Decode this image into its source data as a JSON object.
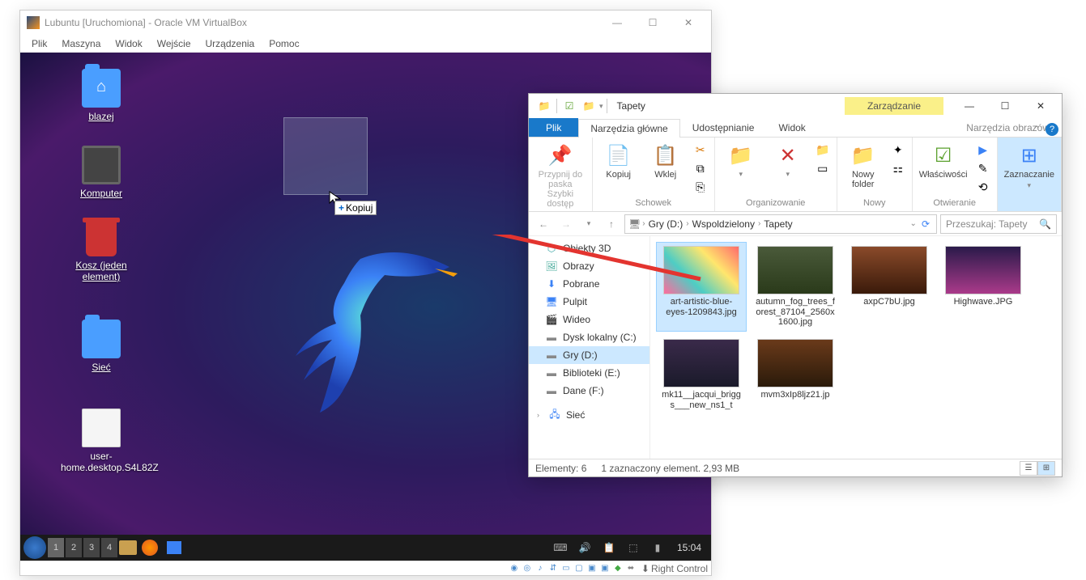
{
  "vbox": {
    "title": "Lubuntu [Uruchomiona] - Oracle VM VirtualBox",
    "menus": [
      "Plik",
      "Maszyna",
      "Widok",
      "Wejście",
      "Urządzenia",
      "Pomoc"
    ],
    "hostkey": "Right Control"
  },
  "desktop_icons": {
    "home": "blazej",
    "computer": "Komputer",
    "trash": "Kosz (jeden element)",
    "network": "Sieć",
    "file": "user-home.desktop.S4L82Z"
  },
  "drag_tooltip": "Kopiuj",
  "taskbar": {
    "desktops": [
      "1",
      "2",
      "3",
      "4"
    ],
    "time": "15:04"
  },
  "explorer": {
    "title": "Tapety",
    "manage_tab": "Zarządzanie",
    "tabs": {
      "file": "Plik",
      "home": "Narzędzia główne",
      "share": "Udostępnianie",
      "view": "Widok",
      "context": "Narzędzia obrazów"
    },
    "ribbon": {
      "pin": "Przypnij do paska Szybki dostęp",
      "copy": "Kopiuj",
      "paste": "Wklej",
      "clipboard": "Schowek",
      "organize": "Organizowanie",
      "newfolder": "Nowy folder",
      "new": "Nowy",
      "properties": "Właściwości",
      "open_group": "Otwieranie",
      "select": "Zaznaczanie"
    },
    "breadcrumbs": [
      "Gry (D:)",
      "Wspoldzielony",
      "Tapety"
    ],
    "search_placeholder": "Przeszukaj: Tapety",
    "nav": {
      "objects3d": "Obiekty 3D",
      "images": "Obrazy",
      "downloads": "Pobrane",
      "desktop": "Pulpit",
      "videos": "Wideo",
      "localc": "Dysk lokalny (C:)",
      "gryd": "Gry (D:)",
      "libe": "Biblioteki (E:)",
      "danef": "Dane (F:)",
      "network": "Sieć"
    },
    "files": [
      {
        "name": "art-artistic-blue-eyes-1209843.jpg",
        "selected": true
      },
      {
        "name": "autumn_fog_trees_forest_87104_2560x1600.jpg"
      },
      {
        "name": "axpC7bU.jpg"
      },
      {
        "name": "Highwave.JPG"
      },
      {
        "name": "mk11__jacqui_briggs___new_ns1_t"
      },
      {
        "name": "mvm3xIp8ljz21.jp"
      }
    ],
    "status": {
      "count": "Elementy: 6",
      "selection": "1 zaznaczony element.  2,93 MB"
    }
  }
}
